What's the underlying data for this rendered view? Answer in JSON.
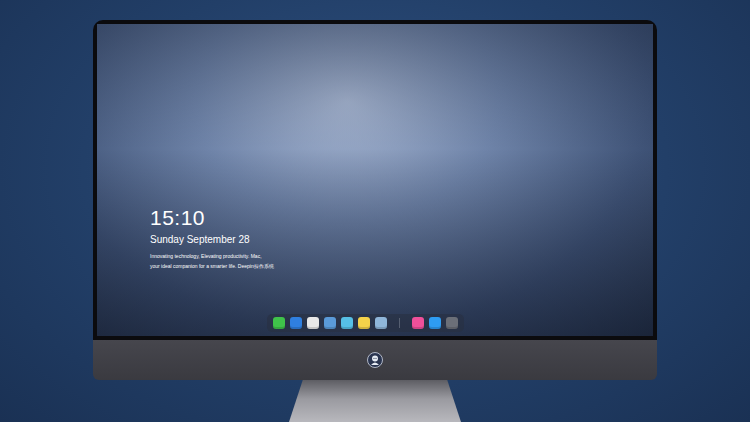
{
  "lock_screen": {
    "time": "15:10",
    "date": "Sunday September 28",
    "slogan_lines": [
      "Innovating technology, Elevating productivity. Mac,",
      "your ideal companion for a smarter life. Deepin操作系统"
    ]
  },
  "dock": {
    "items": [
      {
        "kind": "app",
        "color": "#3fc24a"
      },
      {
        "kind": "app",
        "color": "#2f7fe0"
      },
      {
        "kind": "app",
        "color": "#e8e8e8"
      },
      {
        "kind": "app",
        "color": "#5a9ad8"
      },
      {
        "kind": "app",
        "color": "#56c0e6"
      },
      {
        "kind": "app",
        "color": "#f4d24a"
      },
      {
        "kind": "app",
        "color": "#8fb6d9"
      },
      {
        "kind": "separator",
        "color": "#9aa3b0"
      },
      {
        "kind": "app",
        "color": "#f0509a"
      },
      {
        "kind": "app",
        "color": "#2e9cf2"
      },
      {
        "kind": "app",
        "color": "#6b6f78"
      }
    ]
  }
}
